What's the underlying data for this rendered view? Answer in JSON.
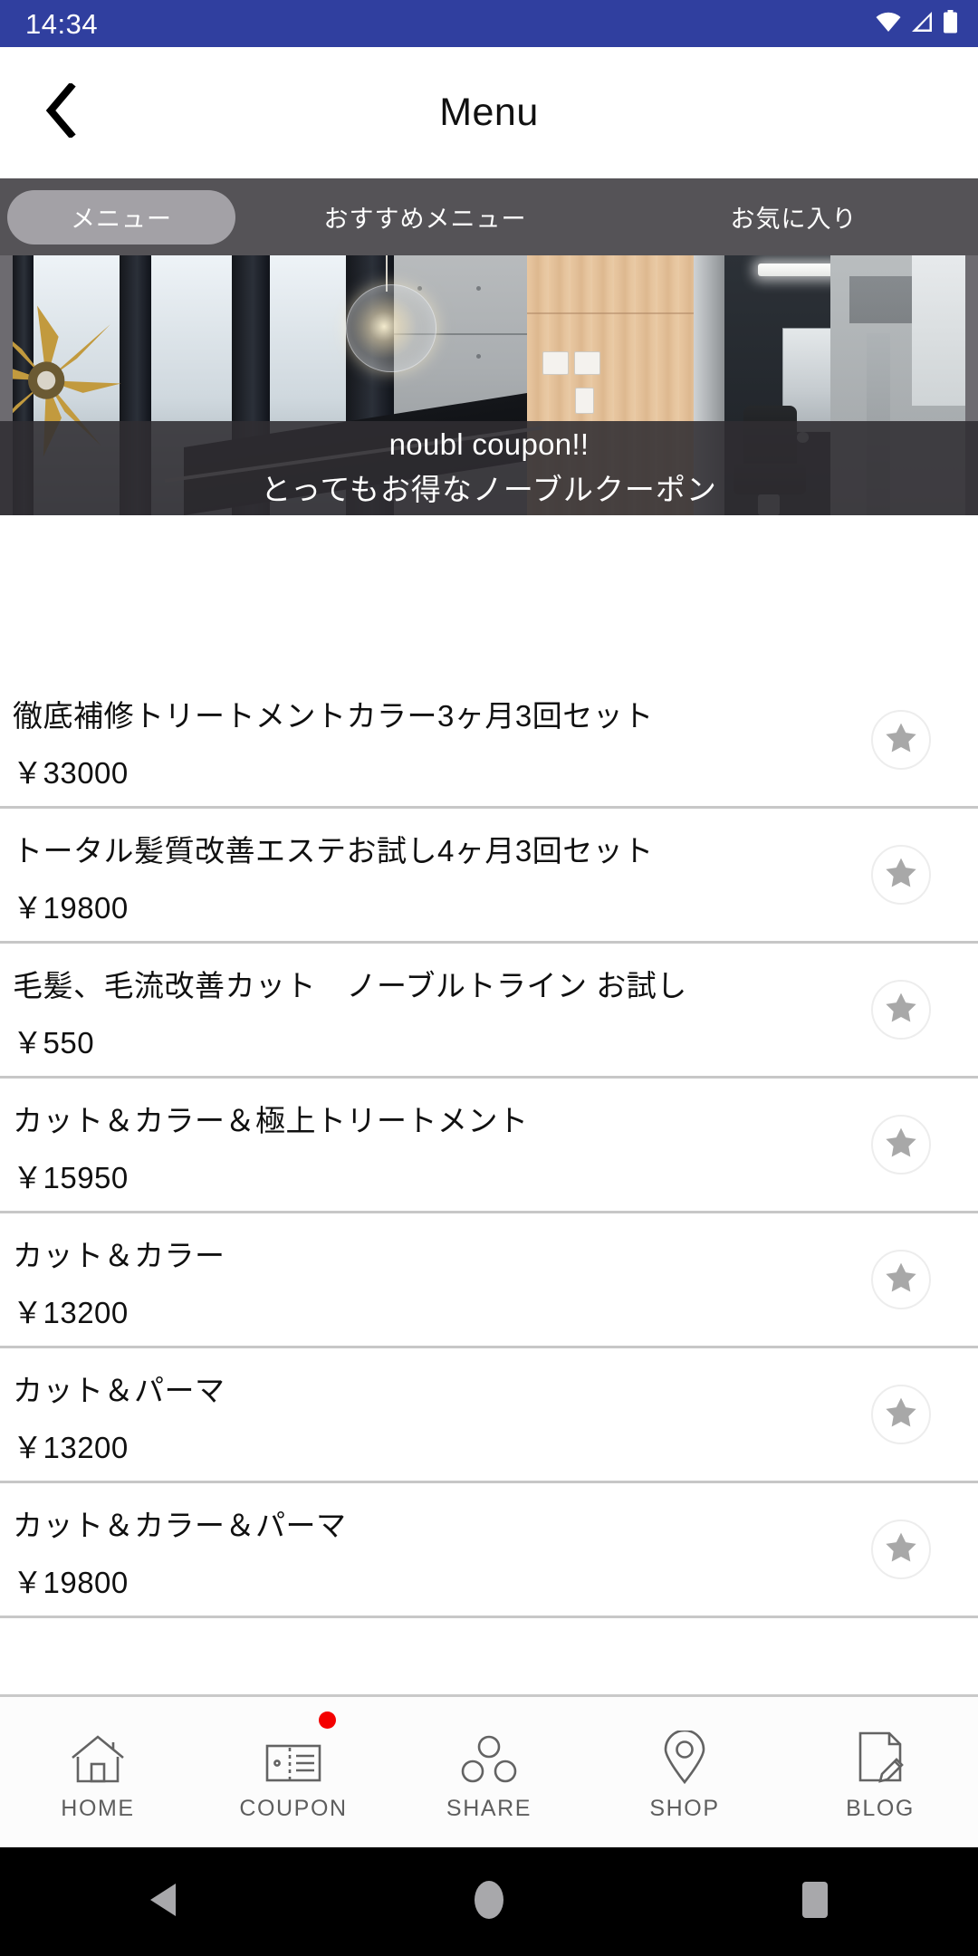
{
  "status_bar": {
    "time": "14:34",
    "icons": [
      "wifi-icon",
      "cellular-signal-icon",
      "battery-icon"
    ],
    "background": "#303f9f"
  },
  "app_bar": {
    "back_icon": "chevron-left-icon",
    "title": "Menu"
  },
  "tabs": {
    "background": "#555357",
    "selected_pill_color": "#a3a1a6",
    "selected_index": 0,
    "items": [
      {
        "label": "メニュー"
      },
      {
        "label": "おすすめメニュー"
      },
      {
        "label": "お気に入り"
      }
    ]
  },
  "banner": {
    "image_alt": "salon-interior-photo",
    "caption_en": "noubl coupon!!",
    "caption_jp": "とってもお得なノーブルクーポン",
    "caption_overlay": "#302e32"
  },
  "menu_list": {
    "favorite_icon": "star-icon",
    "star_color": "#a8a8a8",
    "items": [
      {
        "name": "徹底補修トリートメントカラー3ヶ月3回セット",
        "price": "￥33000"
      },
      {
        "name": "トータル髪質改善エステお試し4ヶ月3回セット",
        "price": "￥19800"
      },
      {
        "name": "毛髪、毛流改善カット　ノーブルトライン お試し",
        "price": "￥550"
      },
      {
        "name": "カット＆カラー＆極上トリートメント",
        "price": "￥15950"
      },
      {
        "name": "カット＆カラー",
        "price": "￥13200"
      },
      {
        "name": "カット＆パーマ",
        "price": "￥13200"
      },
      {
        "name": "カット＆カラー＆パーマ",
        "price": "￥19800"
      }
    ]
  },
  "bottom_nav": {
    "badge_color": "#f40000",
    "items": [
      {
        "label": "HOME",
        "icon": "home-icon",
        "badge": false
      },
      {
        "label": "COUPON",
        "icon": "ticket-icon",
        "badge": true
      },
      {
        "label": "SHARE",
        "icon": "share-icon",
        "badge": false
      },
      {
        "label": "SHOP",
        "icon": "map-pin-icon",
        "badge": false
      },
      {
        "label": "BLOG",
        "icon": "document-pencil-icon",
        "badge": false
      }
    ]
  },
  "android_nav": {
    "items": [
      {
        "name": "back-button",
        "icon": "triangle-left-icon"
      },
      {
        "name": "home-button",
        "icon": "circle-icon"
      },
      {
        "name": "recents-button",
        "icon": "square-icon"
      }
    ]
  }
}
